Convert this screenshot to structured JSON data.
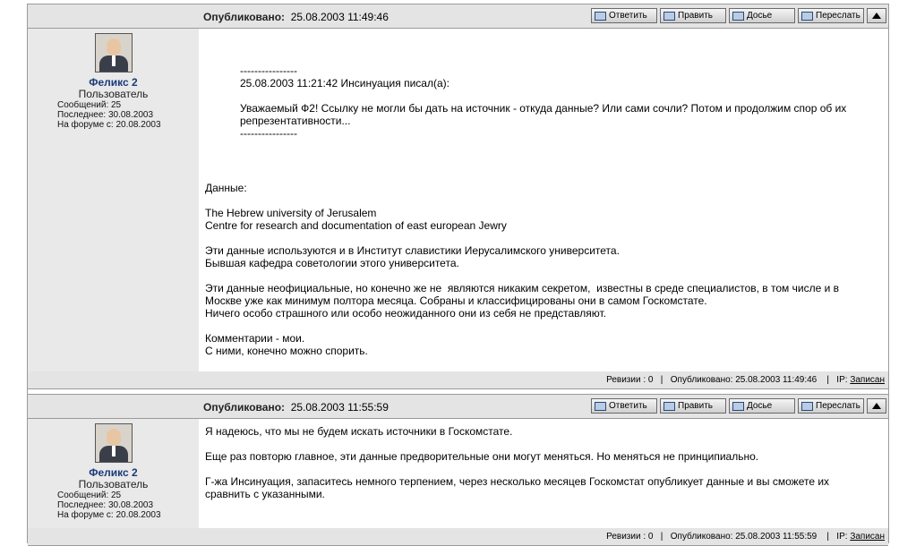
{
  "buttons": {
    "reply": "Ответить",
    "edit": "Править",
    "dossier": "Досье",
    "forward": "Переслать"
  },
  "posts": [
    {
      "published_label": "Опубликовано:",
      "published_date": "25.08.2003 11:49:46",
      "author": {
        "name": "Феликс 2",
        "role": "Пользователь",
        "messages": "Сообщений: 25",
        "last": "Последнее: 30.08.2003",
        "since": "На форуме с: 20.08.2003"
      },
      "quote": "----------------\n25.08.2003 11:21:42 Инсинуация писал(а):\n\nУважаемый Ф2! Ссылку не могли бы дать на источник - откуда данные? Или сами сочли? Потом и продолжим спор об их\nрепрезентативности...\n----------------",
      "text": "Данные:\n\nThe Hebrew university of Jerusalem\nCentre for research and documentation of east european Jewry\n\nЭти данные используются и в Институт славистики Иерусалимского университета.\nБывшая кафедра советологии этого университета.\n\nЭти данные неофициальные, но конечно же не  являются никаким секретом,  известны в среде специалистов, в том числе и в\nМоскве уже как минимум полтора месяца. Собраны и классифицированы они в самом Госкомстате.\nНичего особо страшного или особо неожиданного они из себя не представляют.\n\nКомментарии - мои.\nС ними, конечно можно спорить.",
      "footer": {
        "revisions": "Ревизии : 0",
        "sep": "|",
        "published": "Опубликовано:  25.08.2003 11:49:46",
        "ip_label": "IP:",
        "ip_link": "Записан"
      }
    },
    {
      "published_label": "Опубликовано:",
      "published_date": "25.08.2003 11:55:59",
      "author": {
        "name": "Феликс 2",
        "role": "Пользователь",
        "messages": "Сообщений: 25",
        "last": "Последнее: 30.08.2003",
        "since": "На форуме с: 20.08.2003"
      },
      "text": "Я надеюсь, что мы не будем искать источники в Госкомстате.\n\nЕще раз повторю главное, эти данные предворительные они могут меняться. Но меняться не принципиально.\n\nГ-жа Инсинуация, запаситесь немного терпением, через несколько месяцев Госкомстат опубликует данные и вы сможете их\nсравнить с указанными.",
      "footer": {
        "revisions": "Ревизии : 0",
        "sep": "|",
        "published": "Опубликовано:  25.08.2003 11:55:59",
        "ip_label": "IP:",
        "ip_link": "Записан"
      }
    }
  ]
}
